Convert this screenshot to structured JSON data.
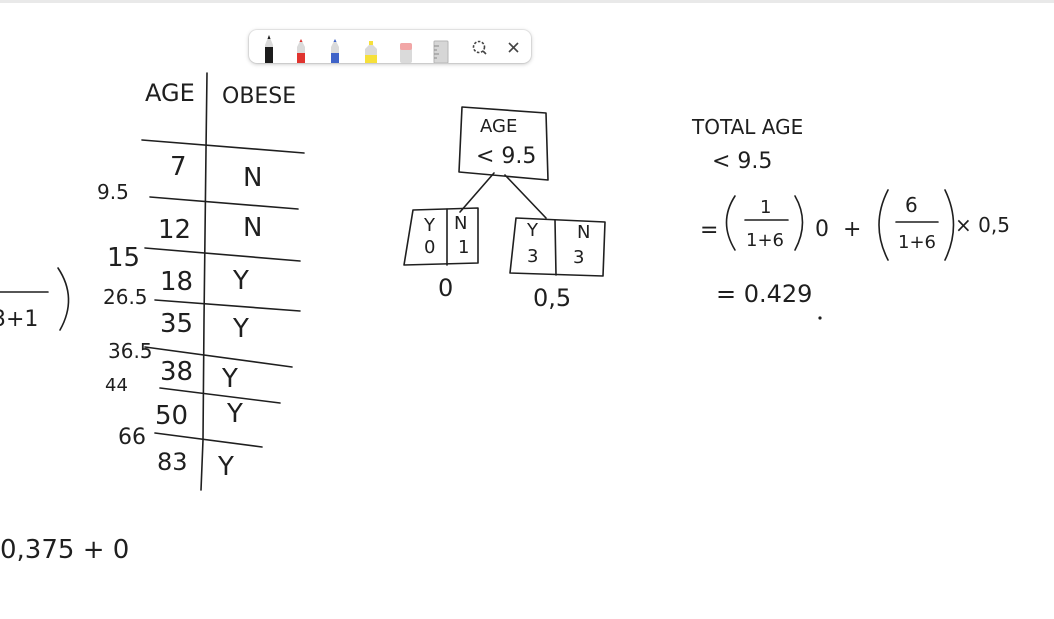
{
  "app": {
    "toolbar": {
      "tools": [
        {
          "name": "black-pen-icon",
          "color": "#1c1c1c"
        },
        {
          "name": "red-pen-icon",
          "color": "#e0342f"
        },
        {
          "name": "blue-pen-icon",
          "color": "#3f63c8"
        },
        {
          "name": "highlighter-icon",
          "color": "#f6e03a"
        },
        {
          "name": "eraser-icon",
          "color": "#f2a6a6"
        },
        {
          "name": "ruler-icon",
          "color": "#c9c9c9"
        },
        {
          "name": "lasso-select-icon",
          "color": "#444444"
        },
        {
          "name": "close-icon",
          "color": "#444444"
        }
      ]
    }
  },
  "whiteboard": {
    "table": {
      "header_age": "AGE",
      "header_obese": "OBESE",
      "rows": [
        {
          "age": "7",
          "obese": "N"
        },
        {
          "age": "12",
          "obese": "N"
        },
        {
          "age": "18",
          "obese": "Y"
        },
        {
          "age": "35",
          "obese": "Y"
        },
        {
          "age": "38",
          "obese": "Y"
        },
        {
          "age": "50",
          "obese": "Y"
        },
        {
          "age": "83",
          "obese": "Y"
        }
      ],
      "thresholds": [
        "9.5",
        "15",
        "26.5",
        "36.5",
        "44",
        "66"
      ]
    },
    "tree": {
      "root_line1": "AGE",
      "root_line2": "< 9.5",
      "left_leaf": {
        "y_label": "Y",
        "y_count": "0",
        "n_label": "N",
        "n_count": "1",
        "gini": "0"
      },
      "right_leaf": {
        "y_label": "Y",
        "y_count": "3",
        "n_label": "N",
        "n_count": "3",
        "gini": "0,5"
      }
    },
    "calc": {
      "line1": "TOTAL AGE",
      "line2": "< 9.5",
      "frac1_num": "1",
      "frac1_den": "1+6",
      "term1_mult": "0",
      "plus": "+",
      "frac2_num": "6",
      "frac2_den": "1+6",
      "term2_mult": "× 0,5",
      "result": "= 0.429"
    },
    "left_partial": {
      "fraction_den": "3+1",
      "bottom_expr": "0,375 + 0"
    }
  }
}
